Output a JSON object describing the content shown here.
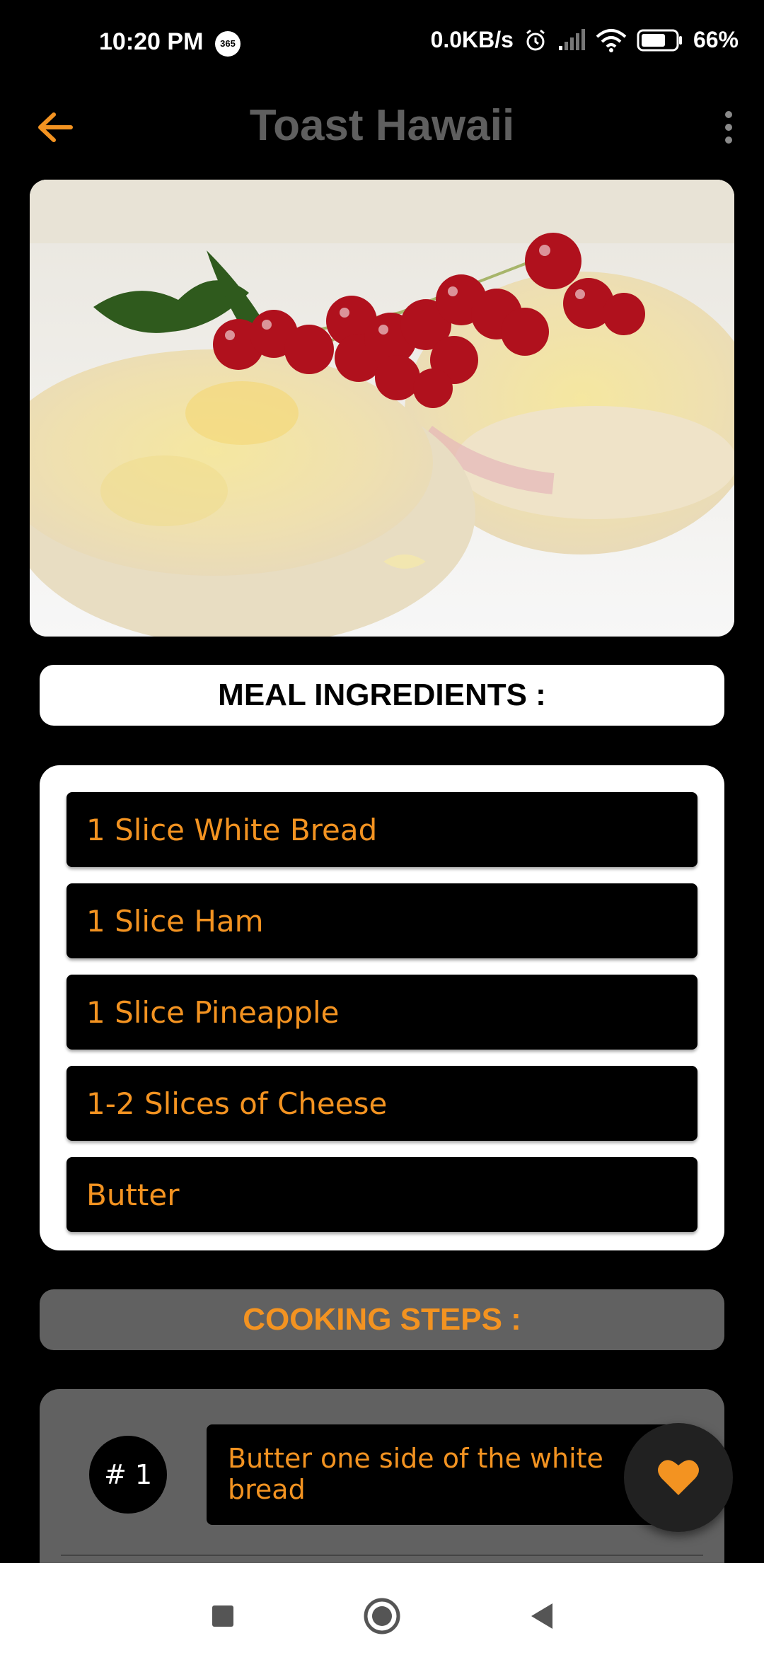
{
  "status_bar": {
    "time": "10:20 PM",
    "badge": "365",
    "net_speed": "0.0KB/s",
    "battery": "66%"
  },
  "app_bar": {
    "title": "Toast Hawaii"
  },
  "sections": {
    "ingredients_header": "MEAL INGREDIENTS :",
    "steps_header": "COOKING STEPS :"
  },
  "ingredients": [
    "1 Slice White Bread",
    "1 Slice Ham",
    "1 Slice Pineapple",
    "1-2 Slices of Cheese",
    "Butter"
  ],
  "steps": [
    {
      "number": "# 1",
      "text": "Butter one side of the white bread"
    }
  ],
  "colors": {
    "accent": "#f39321",
    "title_grey": "#5f5f5f",
    "card_grey": "#616161"
  },
  "icons": [
    "arrow-back-icon",
    "more-vert-icon",
    "heart-icon",
    "alarm-icon",
    "signal-icon",
    "wifi-icon",
    "battery-icon",
    "nav-recents-icon",
    "nav-home-icon",
    "nav-back-icon"
  ]
}
